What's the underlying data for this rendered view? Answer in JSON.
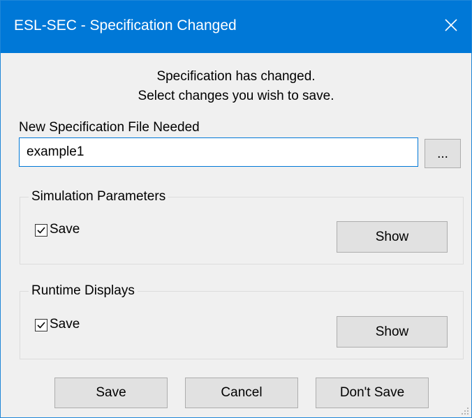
{
  "window": {
    "title": "ESL-SEC - Specification Changed"
  },
  "message": {
    "line1": "Specification has changed.",
    "line2": "Select changes you wish to save."
  },
  "file": {
    "label": "New Specification File Needed",
    "value": "example1",
    "browse_label": "..."
  },
  "groups": [
    {
      "title": "Simulation Parameters",
      "save_label": "Save",
      "save_checked": true,
      "show_label": "Show"
    },
    {
      "title": "Runtime Displays",
      "save_label": "Save",
      "save_checked": true,
      "show_label": "Show"
    }
  ],
  "footer": {
    "save_label": "Save",
    "cancel_label": "Cancel",
    "dont_save_label": "Don't Save"
  },
  "icons": {
    "close": "close-icon",
    "check": "checkmark-icon",
    "grip": "resize-grip-icon"
  },
  "colors": {
    "titlebar": "#0078d7",
    "window_bg": "#f0f0f0",
    "button_bg": "#e1e1e1",
    "input_border": "#0078d7"
  }
}
